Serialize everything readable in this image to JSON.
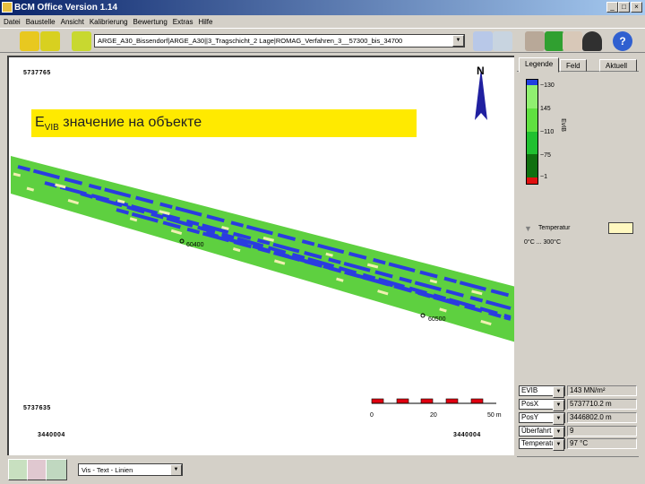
{
  "window": {
    "title": "BCM Office Version 1.14"
  },
  "menu": [
    "Datei",
    "Baustelle",
    "Ansicht",
    "Kalibrierung",
    "Bewertung",
    "Extras",
    "Hilfe"
  ],
  "toolbar": {
    "project": "ARGE_A30_Bissendorf|ARGE_A30||3_Tragschicht_2 Lage|ROMAG_Verfahren_3__57300_bis_34700"
  },
  "map": {
    "coord_top_left": "5737765",
    "coord_bottom_left": "5737635",
    "coord_bottom_x_left": "3440004",
    "coord_bottom_x_right": "3440004",
    "annotation": "значение на объекте",
    "annotation_main": "E",
    "annotation_sub": "VIB",
    "north": "N",
    "station1": "60400",
    "station2": "60500",
    "scale": {
      "labels": [
        "0",
        "20",
        "50 m"
      ]
    }
  },
  "panel": {
    "tabs": [
      "Legende",
      "Feld",
      "Aktuell"
    ],
    "legend": {
      "unit": "EvIB",
      "labels": [
        "~130",
        "145",
        "~110",
        "~75",
        "~1"
      ],
      "colors": [
        "#2040e0",
        "#90f070",
        "#60e040",
        "#20c030",
        "#107010",
        "#e01010"
      ]
    },
    "filter": {
      "label": "Temperatur",
      "range": "0°C ... 300°C",
      "color": "#fff8c0"
    },
    "readouts": [
      {
        "field": "EVIB",
        "value": "143 MN/m²"
      },
      {
        "field": "PosX",
        "value": "5737710.2 m"
      },
      {
        "field": "PosY",
        "value": "3446802.0 m"
      },
      {
        "field": "Überfahrt",
        "value": "9"
      },
      {
        "field": "Temperatur",
        "value": "97 °C"
      }
    ]
  },
  "statusbar": {
    "layer": "Vis - Text - Linien"
  }
}
